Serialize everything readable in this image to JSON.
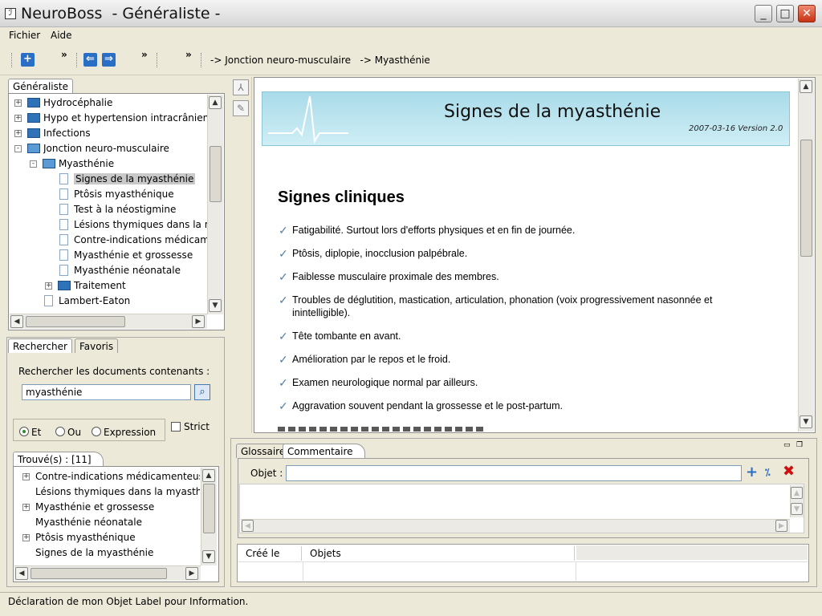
{
  "window": {
    "app_name": "NeuroBoss",
    "title": "NeuroBoss  - Généraliste -",
    "minimize": "_",
    "maximize": "□",
    "close": "✕"
  },
  "menu": [
    "Fichier",
    "Aide"
  ],
  "toolbar": {
    "more1": "»",
    "more2": "»",
    "more3": "»",
    "breadcrumb": "-> Jonction neuro-musculaire   -> Myasthénie"
  },
  "tree_panel": {
    "tab": "Généraliste",
    "items": [
      {
        "label": "Hydrocéphalie",
        "level": 0,
        "kind": "folder",
        "expander": "+"
      },
      {
        "label": "Hypo et hypertension intracrânienne",
        "level": 0,
        "kind": "folder",
        "expander": "+"
      },
      {
        "label": "Infections",
        "level": 0,
        "kind": "folder",
        "expander": "+"
      },
      {
        "label": "Jonction neuro-musculaire",
        "level": 0,
        "kind": "folder-open",
        "expander": "-"
      },
      {
        "label": "Myasthénie",
        "level": 1,
        "kind": "folder-open",
        "expander": "-"
      },
      {
        "label": "Signes de la myasthénie",
        "level": 2,
        "kind": "doc",
        "selected": true
      },
      {
        "label": "Ptôsis myasthénique",
        "level": 2,
        "kind": "doc"
      },
      {
        "label": "Test à la néostigmine",
        "level": 2,
        "kind": "doc"
      },
      {
        "label": "Lésions thymiques dans la my",
        "level": 2,
        "kind": "doc"
      },
      {
        "label": "Contre-indications médicame",
        "level": 2,
        "kind": "doc"
      },
      {
        "label": "Myasthénie et grossesse",
        "level": 2,
        "kind": "doc"
      },
      {
        "label": "Myasthénie néonatale",
        "level": 2,
        "kind": "doc"
      },
      {
        "label": "Traitement",
        "level": 2,
        "kind": "folder",
        "expander": "+"
      },
      {
        "label": "Lambert-Eaton",
        "level": 1,
        "kind": "doc"
      }
    ]
  },
  "search_panel": {
    "tabs": [
      "Rechercher",
      "Favoris"
    ],
    "prompt": "Rechercher les documents contenants :",
    "query": "myasthénie",
    "options": [
      "Et",
      "Ou",
      "Expression"
    ],
    "selected_option": "Et",
    "strict_label": "Strict",
    "results_title": "Trouvé(s) : [11]",
    "results": [
      {
        "label": "Contre-indications médicamenteuses",
        "expander": "+"
      },
      {
        "label": "Lésions thymiques dans la myasthén",
        "expander": ""
      },
      {
        "label": "Myasthénie et grossesse",
        "expander": "+"
      },
      {
        "label": "Myasthénie néonatale",
        "expander": ""
      },
      {
        "label": "Ptôsis myasthénique",
        "expander": "+"
      },
      {
        "label": "Signes de la myasthénie",
        "expander": ""
      }
    ]
  },
  "document": {
    "title": "Signes de la myasthénie",
    "version": "2007-03-16 Version 2.0",
    "section": "Signes cliniques",
    "bullets": [
      "Fatigabilité. Surtout lors d'efforts physiques et en fin de journée.",
      "Ptôsis, diplopie, inocclusion palpébrale.",
      "Faiblesse musculaire proximale des membres.",
      "Troubles de déglutition, mastication, articulation, phonation (voix progressivement nasonnée et inintelligible).",
      "Tête tombante en avant.",
      "Amélioration par le repos et le froid.",
      "Examen neurologique normal par ailleurs.",
      "Aggravation souvent pendant la grossesse et le post-partum."
    ],
    "check_glyph": "✓"
  },
  "comment_panel": {
    "tabs": [
      "Glossaire",
      "Commentaire"
    ],
    "object_label": "Objet :",
    "object_value": "",
    "columns": [
      "Créé le",
      "Objets"
    ]
  },
  "status": "Déclaration de mon Objet Label pour Information.",
  "colors": {
    "accent": "#2a6fc6",
    "header_bg": "#bfe6f0",
    "close_red": "#c53312",
    "delete_red": "#d01010"
  }
}
